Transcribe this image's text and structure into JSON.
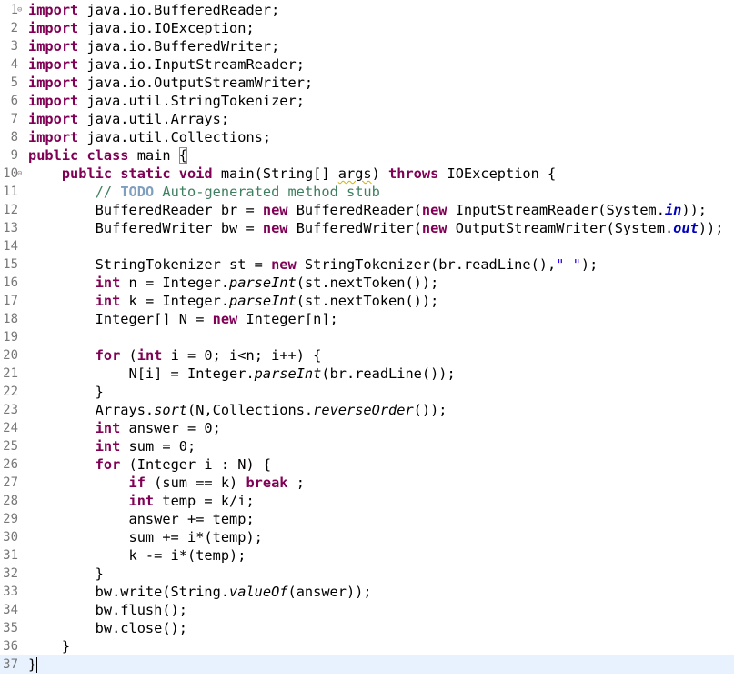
{
  "editor": {
    "lines": [
      {
        "n": "1",
        "fold": "⊖",
        "segs": [
          [
            "kw",
            "import"
          ],
          [
            "",
            "java.io.BufferedReader;"
          ]
        ]
      },
      {
        "n": "2",
        "segs": [
          [
            "kw",
            "import"
          ],
          [
            "",
            "java.io.IOException;"
          ]
        ]
      },
      {
        "n": "3",
        "segs": [
          [
            "kw",
            "import"
          ],
          [
            "",
            "java.io.BufferedWriter;"
          ]
        ]
      },
      {
        "n": "4",
        "segs": [
          [
            "kw",
            "import"
          ],
          [
            "",
            "java.io.InputStreamReader;"
          ]
        ]
      },
      {
        "n": "5",
        "segs": [
          [
            "kw",
            "import"
          ],
          [
            "",
            "java.io.OutputStreamWriter;"
          ]
        ]
      },
      {
        "n": "6",
        "segs": [
          [
            "kw",
            "import"
          ],
          [
            "",
            "java.util.StringTokenizer;"
          ]
        ]
      },
      {
        "n": "7",
        "segs": [
          [
            "kw",
            "import"
          ],
          [
            "",
            "java.util.Arrays;"
          ]
        ]
      },
      {
        "n": "8",
        "segs": [
          [
            "kw",
            "import"
          ],
          [
            "",
            "java.util.Collections;"
          ]
        ]
      },
      {
        "n": "9",
        "segs": [
          [
            "kw",
            "public"
          ],
          [
            "",
            ""
          ],
          [
            "kw",
            "class"
          ],
          [
            "",
            "main "
          ],
          [
            "brace",
            "{"
          ]
        ]
      },
      {
        "n": "10",
        "fold": "⊖",
        "segs": [
          [
            "",
            "    "
          ],
          [
            "kw",
            "public"
          ],
          [
            "",
            ""
          ],
          [
            "kw",
            "static"
          ],
          [
            "",
            ""
          ],
          [
            "kw",
            "void"
          ],
          [
            "",
            "main(String[] "
          ],
          [
            "warn",
            "args"
          ],
          [
            "",
            ") "
          ],
          [
            "kw",
            "throws"
          ],
          [
            "",
            "IOException {"
          ]
        ]
      },
      {
        "n": "11",
        "segs": [
          [
            "",
            "        "
          ],
          [
            "cm",
            "// "
          ],
          [
            "todo",
            "TODO"
          ],
          [
            "cm",
            "Auto-generated method stub"
          ]
        ]
      },
      {
        "n": "12",
        "segs": [
          [
            "",
            "        BufferedReader br = "
          ],
          [
            "kw",
            "new"
          ],
          [
            "",
            "BufferedReader("
          ],
          [
            "kw",
            "new"
          ],
          [
            "",
            "InputStreamReader(System."
          ],
          [
            "fld",
            "in"
          ],
          [
            "",
            "));"
          ]
        ]
      },
      {
        "n": "13",
        "segs": [
          [
            "",
            "        BufferedWriter bw = "
          ],
          [
            "kw",
            "new"
          ],
          [
            "",
            "BufferedWriter("
          ],
          [
            "kw",
            "new"
          ],
          [
            "",
            "OutputStreamWriter(System."
          ],
          [
            "fld",
            "out"
          ],
          [
            "",
            "));"
          ]
        ]
      },
      {
        "n": "14",
        "segs": []
      },
      {
        "n": "15",
        "segs": [
          [
            "",
            "        StringTokenizer st = "
          ],
          [
            "kw",
            "new"
          ],
          [
            "",
            "StringTokenizer(br.readLine(),"
          ],
          [
            "str",
            "\" \""
          ],
          [
            "",
            ");"
          ]
        ]
      },
      {
        "n": "16",
        "segs": [
          [
            "",
            "        "
          ],
          [
            "kw",
            "int"
          ],
          [
            "",
            "n = Integer."
          ],
          [
            "st",
            "parseInt"
          ],
          [
            "",
            "(st.nextToken());"
          ]
        ]
      },
      {
        "n": "17",
        "segs": [
          [
            "",
            "        "
          ],
          [
            "kw",
            "int"
          ],
          [
            "",
            "k = Integer."
          ],
          [
            "st",
            "parseInt"
          ],
          [
            "",
            "(st.nextToken());"
          ]
        ]
      },
      {
        "n": "18",
        "segs": [
          [
            "",
            "        Integer[] N = "
          ],
          [
            "kw",
            "new"
          ],
          [
            "",
            "Integer[n];"
          ]
        ]
      },
      {
        "n": "19",
        "segs": []
      },
      {
        "n": "20",
        "segs": [
          [
            "",
            "        "
          ],
          [
            "kw",
            "for"
          ],
          [
            "",
            "("
          ],
          [
            "kw",
            "int"
          ],
          [
            "",
            "i = 0; i<n; i++) {"
          ]
        ]
      },
      {
        "n": "21",
        "segs": [
          [
            "",
            "            N[i] = Integer."
          ],
          [
            "st",
            "parseInt"
          ],
          [
            "",
            "(br.readLine());"
          ]
        ]
      },
      {
        "n": "22",
        "segs": [
          [
            "",
            "        }"
          ]
        ]
      },
      {
        "n": "23",
        "segs": [
          [
            "",
            "        Arrays."
          ],
          [
            "st",
            "sort"
          ],
          [
            "",
            "(N,Collections."
          ],
          [
            "st",
            "reverseOrder"
          ],
          [
            "",
            "());"
          ]
        ]
      },
      {
        "n": "24",
        "segs": [
          [
            "",
            "        "
          ],
          [
            "kw",
            "int"
          ],
          [
            "",
            "answer = 0;"
          ]
        ]
      },
      {
        "n": "25",
        "segs": [
          [
            "",
            "        "
          ],
          [
            "kw",
            "int"
          ],
          [
            "",
            "sum = 0;"
          ]
        ]
      },
      {
        "n": "26",
        "segs": [
          [
            "",
            "        "
          ],
          [
            "kw",
            "for"
          ],
          [
            "",
            "(Integer i : N) {"
          ]
        ]
      },
      {
        "n": "27",
        "segs": [
          [
            "",
            "            "
          ],
          [
            "kw",
            "if"
          ],
          [
            "",
            "(sum == k) "
          ],
          [
            "kw",
            "break"
          ],
          [
            "",
            ";"
          ]
        ]
      },
      {
        "n": "28",
        "segs": [
          [
            "",
            "            "
          ],
          [
            "kw",
            "int"
          ],
          [
            "",
            "temp = k/i;"
          ]
        ]
      },
      {
        "n": "29",
        "segs": [
          [
            "",
            "            answer += temp;"
          ]
        ]
      },
      {
        "n": "30",
        "segs": [
          [
            "",
            "            sum += i*(temp);"
          ]
        ]
      },
      {
        "n": "31",
        "segs": [
          [
            "",
            "            k -= i*(temp);"
          ]
        ]
      },
      {
        "n": "32",
        "segs": [
          [
            "",
            "        }"
          ]
        ]
      },
      {
        "n": "33",
        "segs": [
          [
            "",
            "        bw.write(String."
          ],
          [
            "st",
            "valueOf"
          ],
          [
            "",
            "(answer));"
          ]
        ]
      },
      {
        "n": "34",
        "segs": [
          [
            "",
            "        bw.flush();"
          ]
        ]
      },
      {
        "n": "35",
        "segs": [
          [
            "",
            "        bw.close();"
          ]
        ]
      },
      {
        "n": "36",
        "segs": [
          [
            "",
            "    }"
          ]
        ]
      },
      {
        "n": "37",
        "current": true,
        "segs": [
          [
            "",
            "}"
          ]
        ]
      }
    ]
  }
}
